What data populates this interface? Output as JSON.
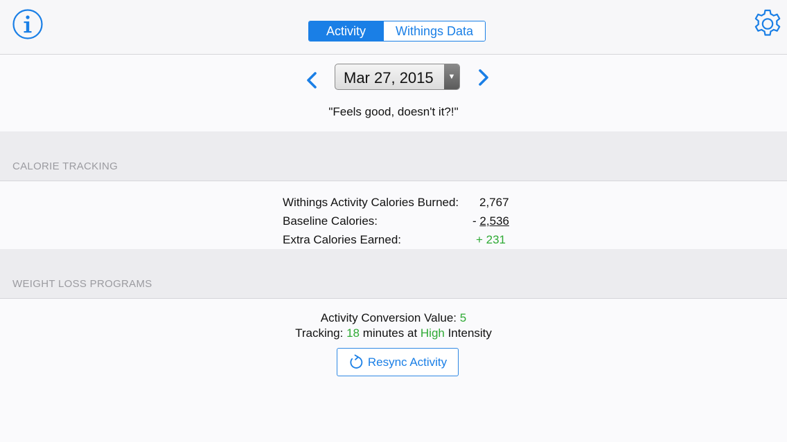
{
  "header": {
    "tabs": [
      {
        "label": "Activity",
        "active": true
      },
      {
        "label": "Withings Data",
        "active": false
      }
    ],
    "info_icon": "info-circle-icon",
    "settings_icon": "gear-icon"
  },
  "date_nav": {
    "date": "Mar 27, 2015",
    "prev_icon": "chevron-left-icon",
    "next_icon": "chevron-right-icon"
  },
  "quote": "\"Feels good, doesn't it?!\"",
  "calorie_tracking": {
    "header": "CALORIE TRACKING",
    "rows": [
      {
        "label": "Withings Activity Calories Burned:",
        "value": "2,767"
      },
      {
        "label": "Baseline Calories:",
        "sign": "- ",
        "value": "2,536"
      },
      {
        "label": "Extra Calories Earned:",
        "value": "+ 231"
      }
    ]
  },
  "weight_loss": {
    "header": "WEIGHT LOSS PROGRAMS",
    "conversion_label": "Activity Conversion Value: ",
    "conversion_value": "5",
    "tracking_prefix": "Tracking: ",
    "tracking_minutes": "18",
    "tracking_mid": " minutes at ",
    "tracking_intensity": "High",
    "tracking_suffix": " Intensity",
    "resync_label": "Resync Activity"
  },
  "colors": {
    "accent": "#1a7fe6",
    "positive": "#2eaa34",
    "section_header_text": "#9b9ba0"
  }
}
